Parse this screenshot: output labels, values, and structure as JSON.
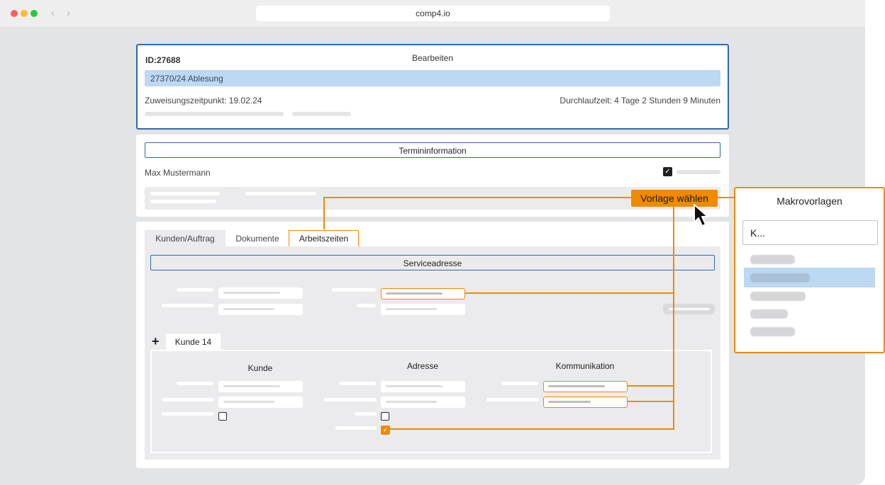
{
  "browser": {
    "url": "comp4.io"
  },
  "header": {
    "id_label": "ID:27688",
    "title": "Bearbeiten",
    "subject": "27370/24 Ablesung",
    "assigned": "Zuweisungszeitpunkt: 19.02.24",
    "duration": "Durchlaufzeit: 4 Tage 2 Stunden 9 Minuten"
  },
  "appointment": {
    "title": "Termininformation",
    "person": "Max Mustermann",
    "template_button": "Vorlage wählen"
  },
  "tabs": [
    {
      "label": "Kunden/Auftrag"
    },
    {
      "label": "Dokumente"
    },
    {
      "label": "Arbeitszeiten"
    }
  ],
  "active_tab": "Arbeitszeiten",
  "service": {
    "title": "Serviceadresse"
  },
  "customer": {
    "add_symbol": "+",
    "tab_label": "Kunde 14",
    "columns": [
      "Kunde",
      "Adresse",
      "Kommunikation"
    ]
  },
  "macros": {
    "title": "Makrovorlagen",
    "search_value": "K..."
  },
  "colors": {
    "accent": "#f08a00",
    "frame_blue": "#2f6aa6",
    "highlight": "#bcd8f3"
  }
}
